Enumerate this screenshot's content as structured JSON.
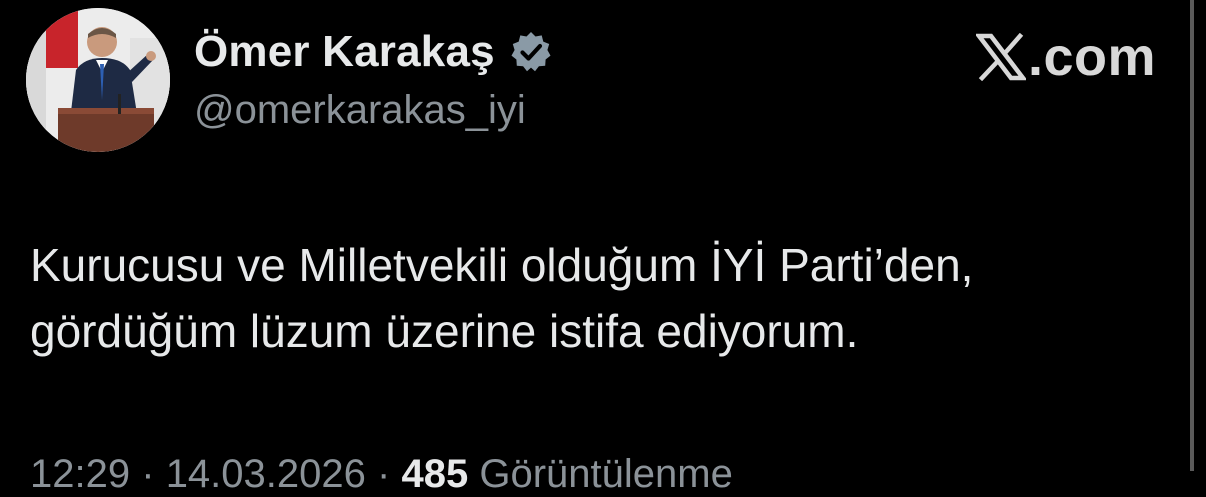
{
  "author": {
    "display_name": "Ömer Karakaş",
    "handle": "@omerkarakas_iyi",
    "verified_badge": "verified-badge-icon",
    "verified_color": "#8a9aa6"
  },
  "brand": {
    "logo": "x-logo-icon",
    "text": ".com"
  },
  "tweet": {
    "lines": [
      "Kurucusu ve Milletvekili olduğum İYİ Parti’den,",
      "gördüğüm lüzum üzerine istifa ediyorum."
    ]
  },
  "meta": {
    "time": "12:29",
    "date": "14.03.2026",
    "separator": "·",
    "views_count": "485",
    "views_label": "Görüntülenme"
  },
  "colors": {
    "background": "#000000",
    "text_primary": "#e7e9ea",
    "text_secondary": "#8b9298"
  }
}
